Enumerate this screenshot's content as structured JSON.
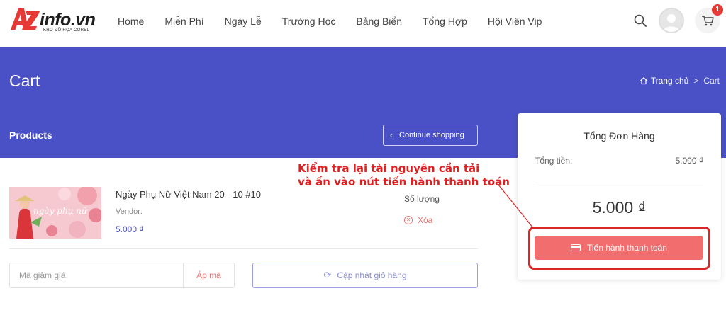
{
  "header": {
    "logo_text": "info.vn",
    "logo_sub": "KHO ĐỒ HỌA COREL",
    "nav": [
      "Home",
      "Miễn Phí",
      "Ngày Lễ",
      "Trường Học",
      "Bảng Biển",
      "Tổng Hợp",
      "Hội Viên Vip"
    ],
    "cart_count": "1",
    "icons": {
      "search": "search-icon",
      "avatar": "user-avatar",
      "cart": "cart-icon"
    }
  },
  "banner": {
    "title": "Cart",
    "breadcrumb": {
      "home": "Trang chủ",
      "current": "Cart"
    },
    "products_title": "Products",
    "continue_label": "Continue shopping"
  },
  "product": {
    "name": "Ngày Phụ Nữ Việt Nam 20 - 10 #10",
    "vendor": "Vendor:",
    "price": "5.000 ₫",
    "qty_label": "Số lượng",
    "remove_label": "Xóa",
    "thumb_text": "ngày phụ nữ"
  },
  "coupon": {
    "placeholder": "Mã giảm giá",
    "apply_label": "Áp mã",
    "update_label": "Cập nhật giỏ hàng"
  },
  "summary": {
    "title": "Tổng Đơn Hàng",
    "subtotal_label": "Tổng tiền:",
    "subtotal_value": "5.000 ₫",
    "total": "5.000 ₫",
    "checkout_label": "Tiến hành thanh toán"
  },
  "annotation": {
    "line1": "Kiểm tra lại tài nguyên cần tải",
    "line2": "và ấn vào nút tiến hành thanh toán"
  },
  "colors": {
    "brand_blue": "#4a51c6",
    "accent_red": "#f26d6d",
    "annotation_red": "#e02020"
  }
}
